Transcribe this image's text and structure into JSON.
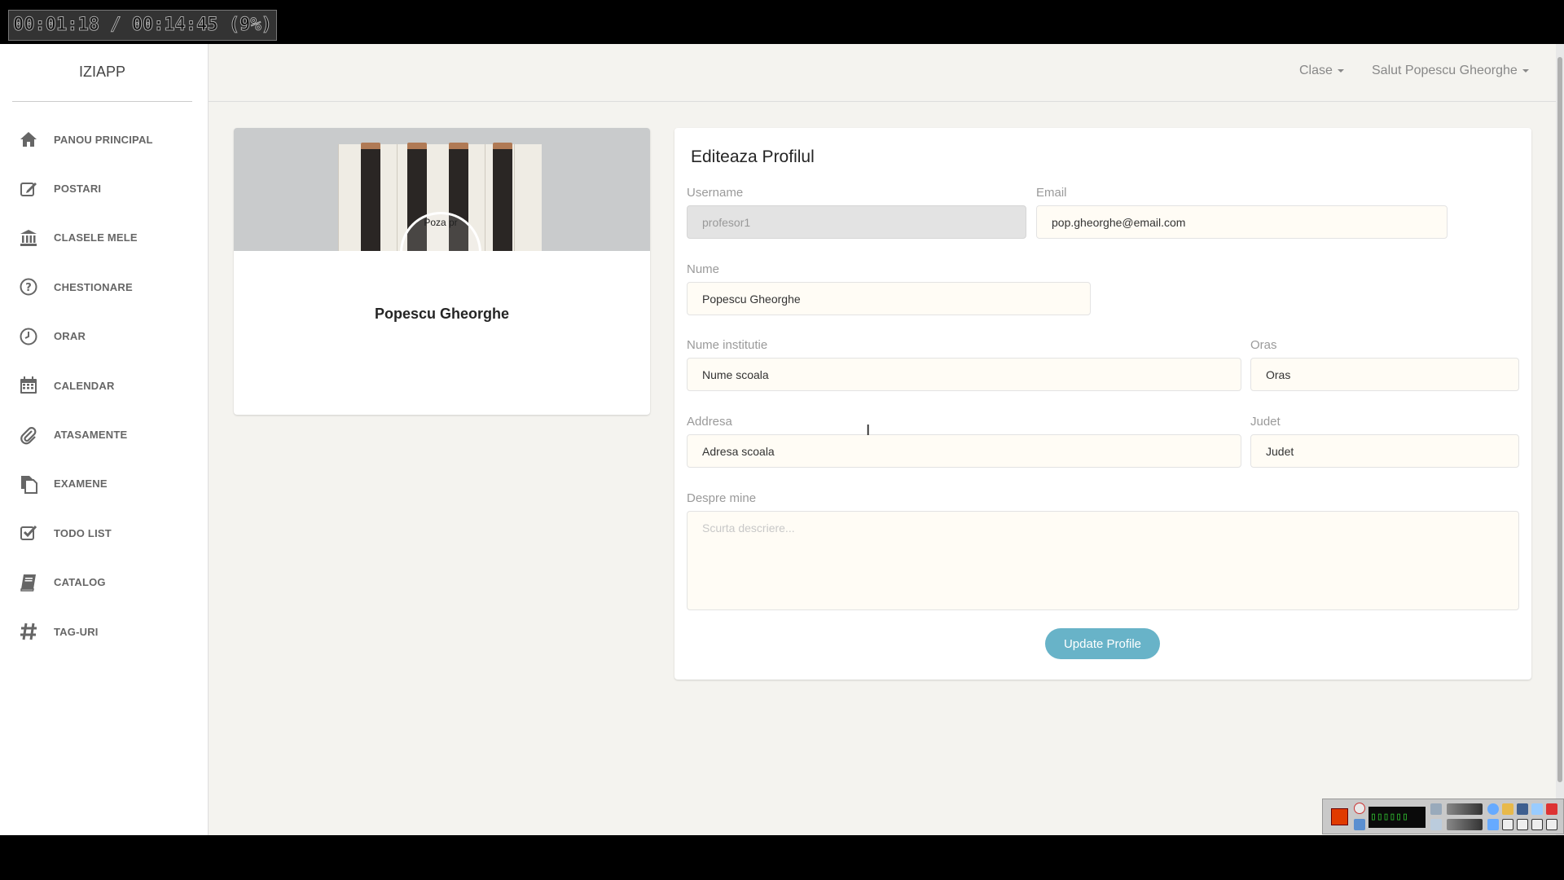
{
  "recording": {
    "time": "00:01:18 / 00:14:45 (9%)"
  },
  "app": {
    "logo": "IZIAPP"
  },
  "sidebar": {
    "items": [
      {
        "label": "PANOU PRINCIPAL",
        "icon": "home-icon"
      },
      {
        "label": "POSTARI",
        "icon": "edit-icon"
      },
      {
        "label": "CLASELE MELE",
        "icon": "bank-icon"
      },
      {
        "label": "CHESTIONARE",
        "icon": "question-icon"
      },
      {
        "label": "ORAR",
        "icon": "clock-icon"
      },
      {
        "label": "CALENDAR",
        "icon": "calendar-icon"
      },
      {
        "label": "ATASAMENTE",
        "icon": "paperclip-icon"
      },
      {
        "label": "EXAMENE",
        "icon": "files-icon"
      },
      {
        "label": "TODO LIST",
        "icon": "checkbox-icon"
      },
      {
        "label": "CATALOG",
        "icon": "book-icon"
      },
      {
        "label": "TAG-URI",
        "icon": "hashtag-icon"
      }
    ]
  },
  "navbar": {
    "classes": "Clase",
    "user": "Salut Popescu Gheorghe"
  },
  "profile": {
    "photo_label": "Poza pr",
    "name": "Popescu Gheorghe"
  },
  "form": {
    "title": "Editeaza Profilul",
    "username": {
      "label": "Username",
      "value": "profesor1"
    },
    "email": {
      "label": "Email",
      "value": "pop.gheorghe@email.com"
    },
    "name": {
      "label": "Nume",
      "value": "Popescu Gheorghe"
    },
    "institution": {
      "label": "Nume institutie",
      "value": "Nume scoala"
    },
    "city": {
      "label": "Oras",
      "value": "Oras"
    },
    "address": {
      "label": "Addresa",
      "value": "Adresa scoala"
    },
    "county": {
      "label": "Judet",
      "value": "Judet"
    },
    "about": {
      "label": "Despre mine",
      "placeholder": "Scurta descriere..."
    },
    "submit": "Update Profile"
  },
  "colors": {
    "accent": "#68b3c8",
    "background": "#f4f3ef",
    "input_bg": "#fffcf5"
  }
}
